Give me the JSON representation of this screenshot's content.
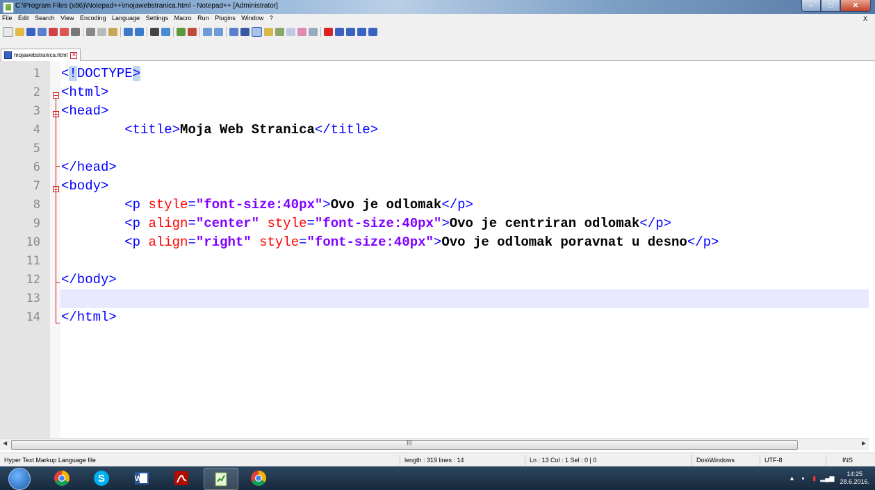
{
  "window": {
    "title": "C:\\Program Files (x86)\\Notepad++\\mojawebstranica.html - Notepad++ [Administrator]"
  },
  "menu": {
    "items": [
      "File",
      "Edit",
      "Search",
      "View",
      "Encoding",
      "Language",
      "Settings",
      "Macro",
      "Run",
      "Plugins",
      "Window",
      "?"
    ],
    "close_doc": "X"
  },
  "tab": {
    "label": "mojawebstranica.html"
  },
  "editor": {
    "current_line": 13,
    "lines": [
      {
        "n": "1",
        "tokens": [
          [
            "t",
            "<"
          ],
          [
            "hl",
            "!"
          ],
          [
            "t",
            "DOCTYPE"
          ],
          [
            "hl",
            ">"
          ]
        ]
      },
      {
        "n": "2",
        "tokens": [
          [
            "t",
            "<html>"
          ]
        ]
      },
      {
        "n": "3",
        "tokens": [
          [
            "t",
            "<head>"
          ]
        ]
      },
      {
        "n": "4",
        "tokens": [
          [
            "p",
            "        "
          ],
          [
            "t",
            "<title>"
          ],
          [
            "x",
            "Moja Web Stranica"
          ],
          [
            "t",
            "</title>"
          ]
        ]
      },
      {
        "n": "5",
        "tokens": []
      },
      {
        "n": "6",
        "tokens": [
          [
            "t",
            "</head>"
          ]
        ]
      },
      {
        "n": "7",
        "tokens": [
          [
            "t",
            "<body>"
          ]
        ]
      },
      {
        "n": "8",
        "tokens": [
          [
            "p",
            "        "
          ],
          [
            "t",
            "<p "
          ],
          [
            "a",
            "style"
          ],
          [
            "t",
            "="
          ],
          [
            "v",
            "\"font-size:40px\""
          ],
          [
            "t",
            ">"
          ],
          [
            "x",
            "Ovo je odlomak"
          ],
          [
            "t",
            "</p>"
          ]
        ]
      },
      {
        "n": "9",
        "tokens": [
          [
            "p",
            "        "
          ],
          [
            "t",
            "<p "
          ],
          [
            "a",
            "align"
          ],
          [
            "t",
            "="
          ],
          [
            "v",
            "\"center\""
          ],
          [
            "p",
            " "
          ],
          [
            "a",
            "style"
          ],
          [
            "t",
            "="
          ],
          [
            "v",
            "\"font-size:40px\""
          ],
          [
            "t",
            ">"
          ],
          [
            "x",
            "Ovo je centriran odlomak"
          ],
          [
            "t",
            "</p>"
          ]
        ]
      },
      {
        "n": "10",
        "tokens": [
          [
            "p",
            "        "
          ],
          [
            "t",
            "<p "
          ],
          [
            "a",
            "align"
          ],
          [
            "t",
            "="
          ],
          [
            "v",
            "\"right\""
          ],
          [
            "p",
            " "
          ],
          [
            "a",
            "style"
          ],
          [
            "t",
            "="
          ],
          [
            "v",
            "\"font-size:40px\""
          ],
          [
            "t",
            ">"
          ],
          [
            "x",
            "Ovo je odlomak poravnat u desno"
          ],
          [
            "t",
            "</p>"
          ]
        ]
      },
      {
        "n": "11",
        "tokens": []
      },
      {
        "n": "12",
        "tokens": [
          [
            "t",
            "</body>"
          ]
        ]
      },
      {
        "n": "13",
        "tokens": []
      },
      {
        "n": "14",
        "tokens": [
          [
            "t",
            "</html>"
          ]
        ]
      }
    ]
  },
  "statusbar": {
    "language": "Hyper Text Markup Language file",
    "length": "length : 319    lines : 14",
    "position": "Ln : 13    Col : 1    Sel : 0 | 0",
    "eol": "Dos\\Windows",
    "encoding": "UTF-8",
    "mode": "INS"
  },
  "scrollbar": {
    "grip": "III"
  },
  "taskbar": {
    "time": "14:25",
    "date": "28.6.2016."
  },
  "colors": {
    "tag": "#0000ff",
    "attribute": "#ff0000",
    "value": "#8000ff",
    "text": "#000000",
    "current_line": "#e8e8ff",
    "fold_marker": "#cc1111"
  }
}
